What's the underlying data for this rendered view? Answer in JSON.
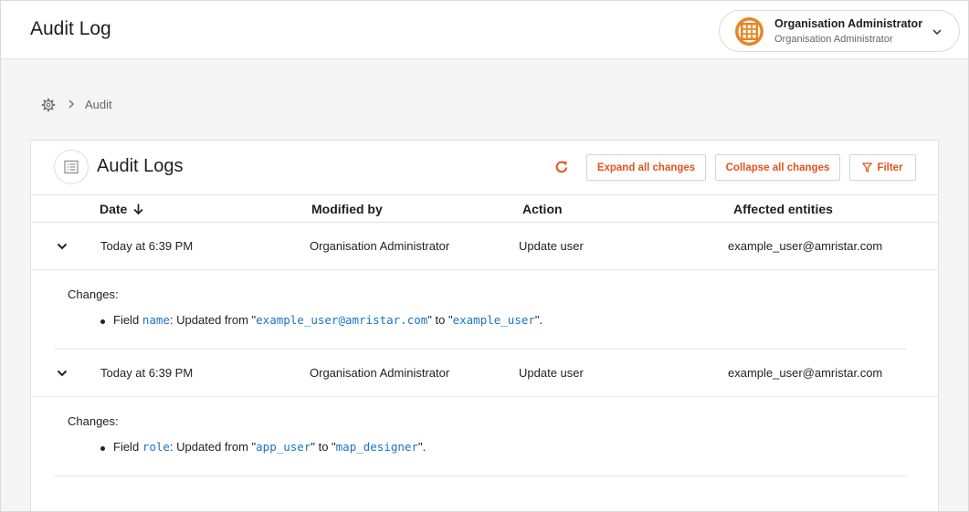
{
  "header": {
    "title": "Audit Log",
    "user": {
      "name": "Organisation Administrator",
      "role": "Organisation Administrator"
    }
  },
  "breadcrumb": {
    "current": "Audit"
  },
  "card": {
    "title": "Audit Logs",
    "expand_label": "Expand all changes",
    "collapse_label": "Collapse all changes",
    "filter_label": "Filter",
    "accent_color": "#e4531b"
  },
  "table": {
    "columns": [
      "Date",
      "Modified by",
      "Action",
      "Affected entities"
    ],
    "rows": [
      {
        "date": "Today at 6:39 PM",
        "modified_by": "Organisation Administrator",
        "action": "Update user",
        "affected": "example_user@amristar.com",
        "changes_label": "Changes:",
        "change": {
          "prefix": "Field",
          "field": "name",
          "middle": ": Updated from \"",
          "from": "example_user@amristar.com",
          "to_text": "\" to \"",
          "to": "example_user",
          "suffix": "\"."
        }
      },
      {
        "date": "Today at 6:39 PM",
        "modified_by": "Organisation Administrator",
        "action": "Update user",
        "affected": "example_user@amristar.com",
        "changes_label": "Changes:",
        "change": {
          "prefix": "Field",
          "field": "role",
          "middle": ": Updated from \"",
          "from": "app_user",
          "to_text": "\" to \"",
          "to": "map_designer",
          "suffix": "\"."
        }
      }
    ]
  },
  "icons": {
    "avatar": "organisation-logo-icon",
    "chevron": "chevron-down-icon",
    "settings": "gear-icon",
    "breadcrumb_sep": "chevron-right-icon",
    "card": "list-icon",
    "refresh": "refresh-icon",
    "filter": "filter-icon",
    "sort": "arrow-down-icon"
  }
}
